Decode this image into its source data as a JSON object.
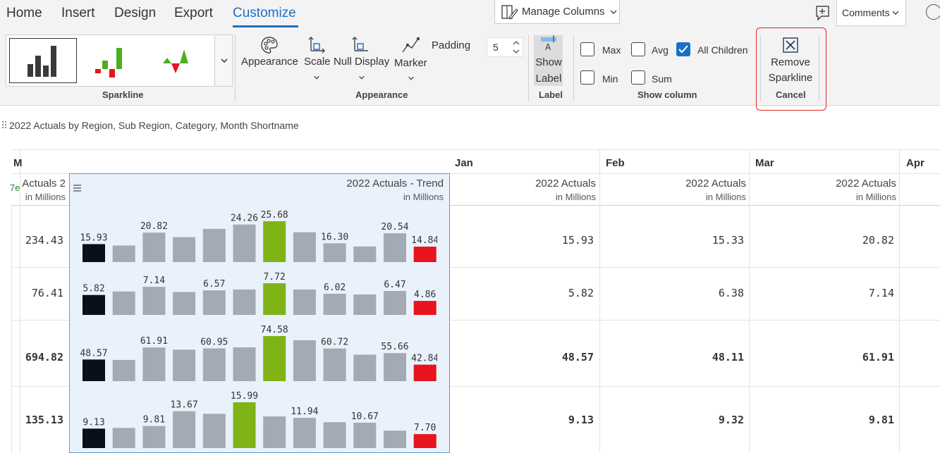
{
  "ribbon": {
    "tabs": [
      "Home",
      "Insert",
      "Design",
      "Export",
      "Customize"
    ],
    "manage_columns": "Manage Columns",
    "comments": "Comments",
    "group_sparkline": "Sparkline",
    "group_appearance": "Appearance",
    "group_label": "Label",
    "group_show_column": "Show column",
    "appearance": "Appearance",
    "scale": "Scale",
    "null_display": "Null Display",
    "marker": "Marker",
    "padding_label": "Padding",
    "padding_value": "5",
    "show": "Show",
    "label": "Label",
    "show_column": [
      {
        "label": "Max",
        "checked": false
      },
      {
        "label": "Avg",
        "checked": false
      },
      {
        "label": "All Children",
        "checked": true
      },
      {
        "label": "Min",
        "checked": false
      },
      {
        "label": "Sum",
        "checked": false
      }
    ],
    "remove": "Remove",
    "sparkline": "Sparkline",
    "cancel": "Cancel"
  },
  "report": {
    "title": "2022 Actuals by Region, Sub Region, Category, Month Shortname",
    "first_col_header": "M",
    "first_col_partial": "7e",
    "months": [
      "Jan",
      "Feb",
      "Mar",
      "Apr"
    ],
    "actuals_header": "2022 Actuals",
    "actuals_header_partial": "2 Actuals",
    "units": "in Millions",
    "trend_header": "2022 Actuals - Trend",
    "colors": {
      "first": "#0b0f1a",
      "max": "#7fb316",
      "min": "#e8131c",
      "normal": "#a4aab3"
    },
    "rows": [
      {
        "total": "234.43",
        "bold": false,
        "jan": "15.93",
        "feb": "15.33",
        "mar": "20.82",
        "spark": [
          15.93,
          15.33,
          20.82,
          18.9,
          22.4,
          24.26,
          25.68,
          21.0,
          16.3,
          14.9,
          20.54,
          14.84
        ],
        "labels": [
          "15.93",
          "",
          "20.82",
          "",
          "",
          "24.26",
          "25.68",
          "",
          "16.30",
          "",
          "20.54",
          "14.84"
        ]
      },
      {
        "total": "76.41",
        "bold": false,
        "jan": "5.82",
        "feb": "6.38",
        "mar": "7.14",
        "spark": [
          5.82,
          6.38,
          7.14,
          6.3,
          6.57,
          6.7,
          7.72,
          6.7,
          6.02,
          5.9,
          6.47,
          4.86
        ],
        "labels": [
          "5.82",
          "",
          "7.14",
          "",
          "6.57",
          "",
          "7.72",
          "",
          "6.02",
          "",
          "6.47",
          "4.86"
        ]
      },
      {
        "total": "694.82",
        "bold": true,
        "jan": "48.57",
        "feb": "48.11",
        "mar": "61.91",
        "spark": [
          48.57,
          48.11,
          61.91,
          59.5,
          60.95,
          62.0,
          74.58,
          70.0,
          60.72,
          54.0,
          55.66,
          42.84
        ],
        "labels": [
          "48.57",
          "",
          "61.91",
          "",
          "60.95",
          "",
          "74.58",
          "",
          "60.72",
          "",
          "55.66",
          "42.84"
        ]
      },
      {
        "total": "135.13",
        "bold": true,
        "jan": "9.13",
        "feb": "9.32",
        "mar": "9.81",
        "spark": [
          9.13,
          9.32,
          9.81,
          13.67,
          13.0,
          15.99,
          12.3,
          11.94,
          10.8,
          10.67,
          8.6,
          7.7
        ],
        "labels": [
          "9.13",
          "",
          "9.81",
          "13.67",
          "",
          "15.99",
          "",
          "11.94",
          "",
          "10.67",
          "",
          "7.70"
        ]
      }
    ]
  }
}
